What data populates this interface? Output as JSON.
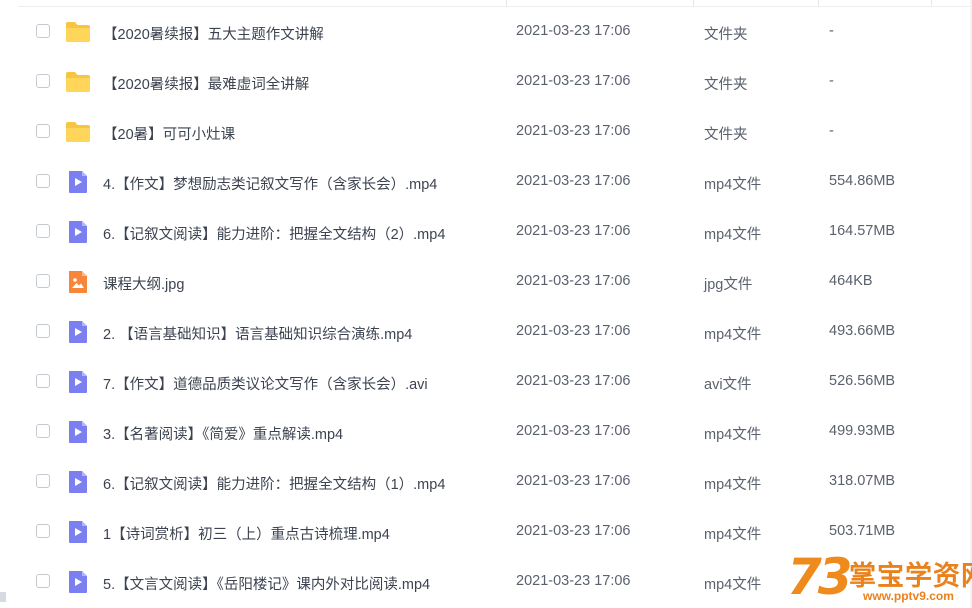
{
  "files": [
    {
      "name": "【2020暑续报】五大主题作文讲解",
      "time": "2021-03-23 17:06",
      "type": "文件夹",
      "size": "-",
      "icon": "folder-icon"
    },
    {
      "name": "【2020暑续报】最难虚词全讲解",
      "time": "2021-03-23 17:06",
      "type": "文件夹",
      "size": "-",
      "icon": "folder-icon"
    },
    {
      "name": "【20暑】可可小灶课",
      "time": "2021-03-23 17:06",
      "type": "文件夹",
      "size": "-",
      "icon": "folder-icon"
    },
    {
      "name": "4.【作文】梦想励志类记叙文写作（含家长会）.mp4",
      "time": "2021-03-23 17:06",
      "type": "mp4文件",
      "size": "554.86MB",
      "icon": "video-file-icon"
    },
    {
      "name": "6.【记叙文阅读】能力进阶：把握全文结构（2）.mp4",
      "time": "2021-03-23 17:06",
      "type": "mp4文件",
      "size": "164.57MB",
      "icon": "video-file-icon"
    },
    {
      "name": "课程大纲.jpg",
      "time": "2021-03-23 17:06",
      "type": "jpg文件",
      "size": "464KB",
      "icon": "image-file-icon"
    },
    {
      "name": "2. 【语言基础知识】语言基础知识综合演练.mp4",
      "time": "2021-03-23 17:06",
      "type": "mp4文件",
      "size": "493.66MB",
      "icon": "video-file-icon"
    },
    {
      "name": "7.【作文】道德品质类议论文写作（含家长会）.avi",
      "time": "2021-03-23 17:06",
      "type": "avi文件",
      "size": "526.56MB",
      "icon": "video-file-icon"
    },
    {
      "name": "3.【名著阅读】《简爱》重点解读.mp4",
      "time": "2021-03-23 17:06",
      "type": "mp4文件",
      "size": "499.93MB",
      "icon": "video-file-icon"
    },
    {
      "name": "6.【记叙文阅读】能力进阶：把握全文结构（1）.mp4",
      "time": "2021-03-23 17:06",
      "type": "mp4文件",
      "size": "318.07MB",
      "icon": "video-file-icon"
    },
    {
      "name": "1【诗词赏析】初三（上）重点古诗梳理.mp4",
      "time": "2021-03-23 17:06",
      "type": "mp4文件",
      "size": "503.71MB",
      "icon": "video-file-icon"
    },
    {
      "name": "5.【文言文阅读】《岳阳楼记》课内外对比阅读.mp4",
      "time": "2021-03-23 17:06",
      "type": "mp4文件",
      "size": "",
      "icon": "video-file-icon"
    }
  ],
  "watermark": {
    "logo": "73",
    "title": "掌宝学资网",
    "url": "www.pptv9.com"
  },
  "colors": {
    "folder": "#f7c544",
    "video": "#7b7ff0",
    "image": "#f7853a",
    "watermark": "#e9821c"
  }
}
